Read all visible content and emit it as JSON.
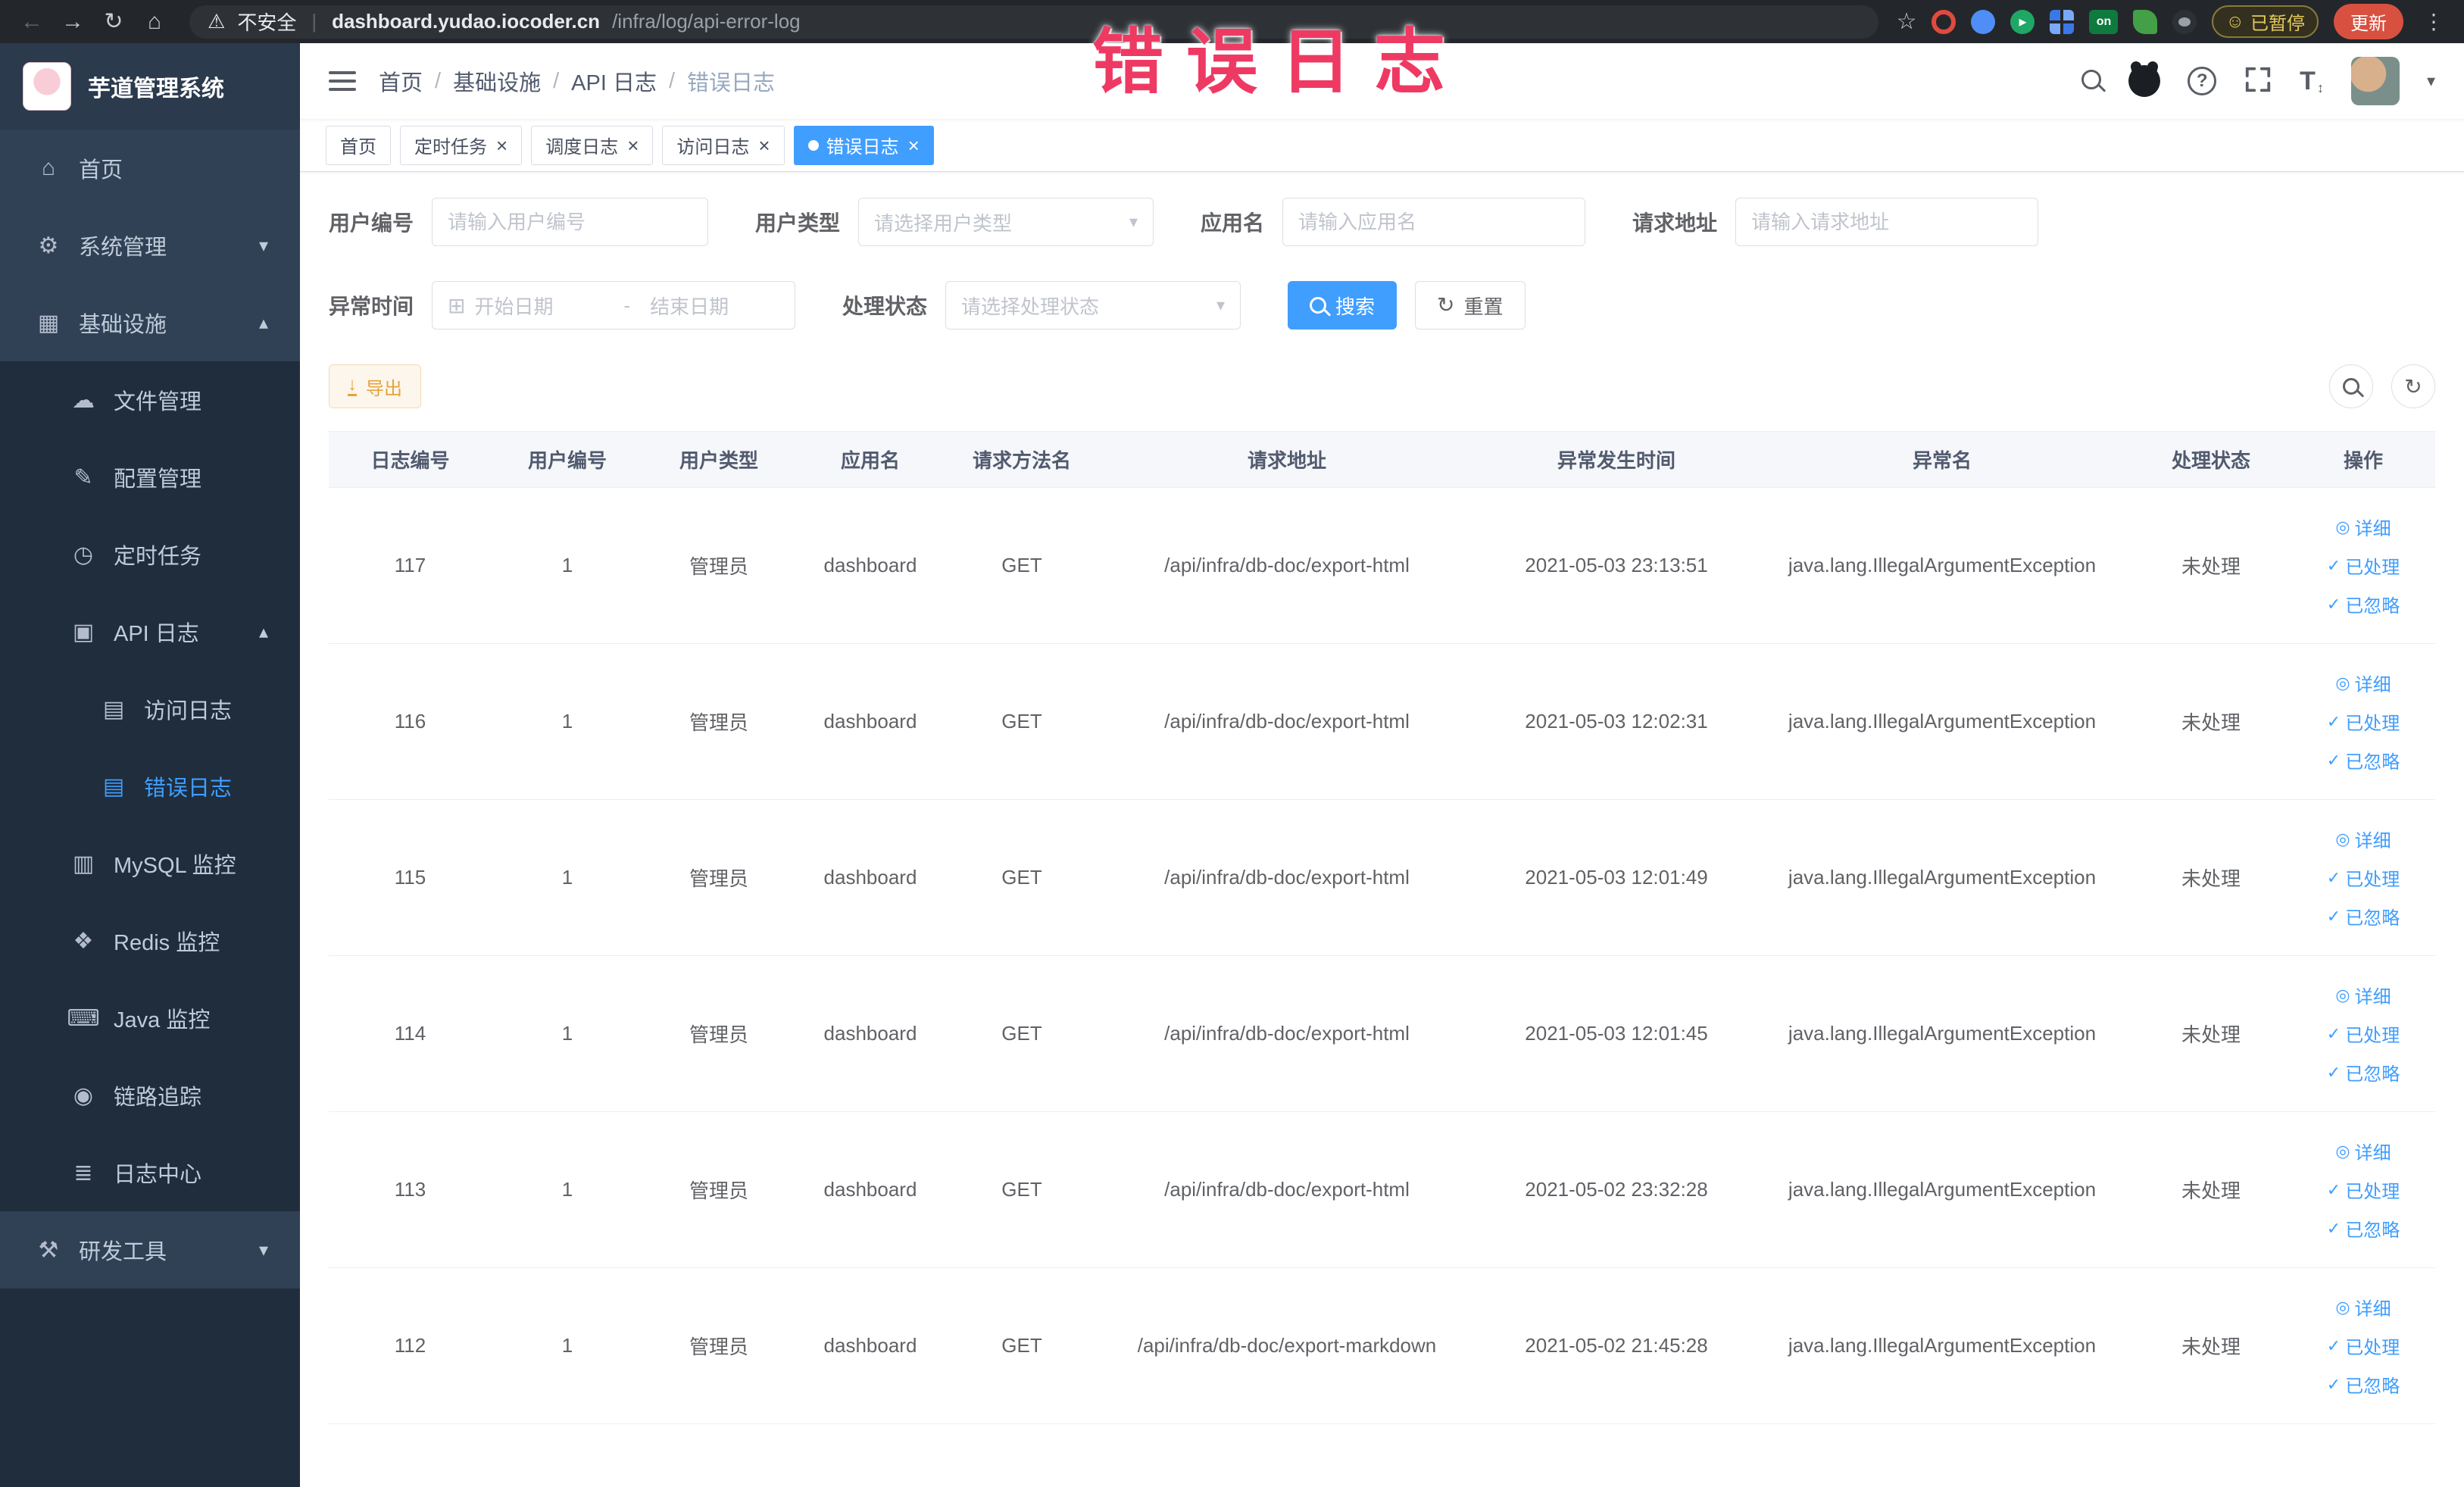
{
  "browser": {
    "security_label": "不安全",
    "url_host": "dashboard.yudao.iocoder.cn",
    "url_path": "/infra/log/api-error-log",
    "paused_badge": "已暂停",
    "update_button": "更新"
  },
  "annotation": {
    "text": "错误日志",
    "color": "#ee3a63"
  },
  "icon_glyphs": {
    "home": "⌂",
    "system": "⚙",
    "infra": "▦",
    "file": "☁",
    "config": "✎",
    "job": "◷",
    "api-log": "▣",
    "doc": "▤",
    "mysql": "▥",
    "redis": "❖",
    "java": "⌨",
    "trace": "◉",
    "log-center": "≣",
    "tools": "⚒"
  },
  "sidebar": {
    "app_title": "芋道管理系统",
    "items": [
      {
        "key": "home",
        "label": "首页",
        "icon": "home",
        "level": 0
      },
      {
        "key": "system",
        "label": "系统管理",
        "icon": "system",
        "level": 0,
        "arrow": "down"
      },
      {
        "key": "infra",
        "label": "基础设施",
        "icon": "infra",
        "level": 0,
        "arrow": "up"
      },
      {
        "key": "file",
        "label": "文件管理",
        "icon": "file",
        "level": 1
      },
      {
        "key": "config",
        "label": "配置管理",
        "icon": "config",
        "level": 1
      },
      {
        "key": "job",
        "label": "定时任务",
        "icon": "job",
        "level": 1
      },
      {
        "key": "api-log",
        "label": "API 日志",
        "icon": "api-log",
        "level": 1,
        "arrow": "up"
      },
      {
        "key": "access-log",
        "label": "访问日志",
        "icon": "doc",
        "level": 2
      },
      {
        "key": "error-log",
        "label": "错误日志",
        "icon": "doc",
        "level": 2,
        "active": true
      },
      {
        "key": "mysql",
        "label": "MySQL 监控",
        "icon": "mysql",
        "level": 1
      },
      {
        "key": "redis",
        "label": "Redis 监控",
        "icon": "redis",
        "level": 1
      },
      {
        "key": "java",
        "label": "Java 监控",
        "icon": "java",
        "level": 1
      },
      {
        "key": "trace",
        "label": "链路追踪",
        "icon": "trace",
        "level": 1
      },
      {
        "key": "log-center",
        "label": "日志中心",
        "icon": "log-center",
        "level": 1
      },
      {
        "key": "dev-tools",
        "label": "研发工具",
        "icon": "tools",
        "level": 0,
        "arrow": "down"
      }
    ]
  },
  "breadcrumb": [
    "首页",
    "基础设施",
    "API 日志",
    "错误日志"
  ],
  "tabs": [
    {
      "label": "首页",
      "closable": false,
      "active": false
    },
    {
      "label": "定时任务",
      "closable": true,
      "active": false
    },
    {
      "label": "调度日志",
      "closable": true,
      "active": false
    },
    {
      "label": "访问日志",
      "closable": true,
      "active": false
    },
    {
      "label": "错误日志",
      "closable": true,
      "active": true
    }
  ],
  "filters": {
    "user_id": {
      "label": "用户编号",
      "placeholder": "请输入用户编号"
    },
    "user_type": {
      "label": "用户类型",
      "placeholder": "请选择用户类型"
    },
    "app_name": {
      "label": "应用名",
      "placeholder": "请输入应用名"
    },
    "request_url": {
      "label": "请求地址",
      "placeholder": "请输入请求地址"
    },
    "exception_time": {
      "label": "异常时间",
      "start_placeholder": "开始日期",
      "end_placeholder": "结束日期",
      "separator": "-"
    },
    "process_status": {
      "label": "处理状态",
      "placeholder": "请选择处理状态"
    },
    "search_label": "搜索",
    "reset_label": "重置"
  },
  "toolbar": {
    "export_label": "导出"
  },
  "table": {
    "columns": [
      "日志编号",
      "用户编号",
      "用户类型",
      "应用名",
      "请求方法名",
      "请求地址",
      "异常发生时间",
      "异常名",
      "处理状态",
      "操作"
    ],
    "actions": [
      "详细",
      "已处理",
      "已忽略"
    ],
    "rows": [
      {
        "id": "117",
        "user_id": "1",
        "user_type": "管理员",
        "app": "dashboard",
        "method": "GET",
        "url": "/api/infra/db-doc/export-html",
        "time": "2021-05-03 23:13:51",
        "exception": "java.lang.IllegalArgumentException",
        "status": "未处理"
      },
      {
        "id": "116",
        "user_id": "1",
        "user_type": "管理员",
        "app": "dashboard",
        "method": "GET",
        "url": "/api/infra/db-doc/export-html",
        "time": "2021-05-03 12:02:31",
        "exception": "java.lang.IllegalArgumentException",
        "status": "未处理"
      },
      {
        "id": "115",
        "user_id": "1",
        "user_type": "管理员",
        "app": "dashboard",
        "method": "GET",
        "url": "/api/infra/db-doc/export-html",
        "time": "2021-05-03 12:01:49",
        "exception": "java.lang.IllegalArgumentException",
        "status": "未处理"
      },
      {
        "id": "114",
        "user_id": "1",
        "user_type": "管理员",
        "app": "dashboard",
        "method": "GET",
        "url": "/api/infra/db-doc/export-html",
        "time": "2021-05-03 12:01:45",
        "exception": "java.lang.IllegalArgumentException",
        "status": "未处理"
      },
      {
        "id": "113",
        "user_id": "1",
        "user_type": "管理员",
        "app": "dashboard",
        "method": "GET",
        "url": "/api/infra/db-doc/export-html",
        "time": "2021-05-02 23:32:28",
        "exception": "java.lang.IllegalArgumentException",
        "status": "未处理"
      },
      {
        "id": "112",
        "user_id": "1",
        "user_type": "管理员",
        "app": "dashboard",
        "method": "GET",
        "url": "/api/infra/db-doc/export-markdown",
        "time": "2021-05-02 21:45:28",
        "exception": "java.lang.IllegalArgumentException",
        "status": "未处理"
      }
    ]
  }
}
